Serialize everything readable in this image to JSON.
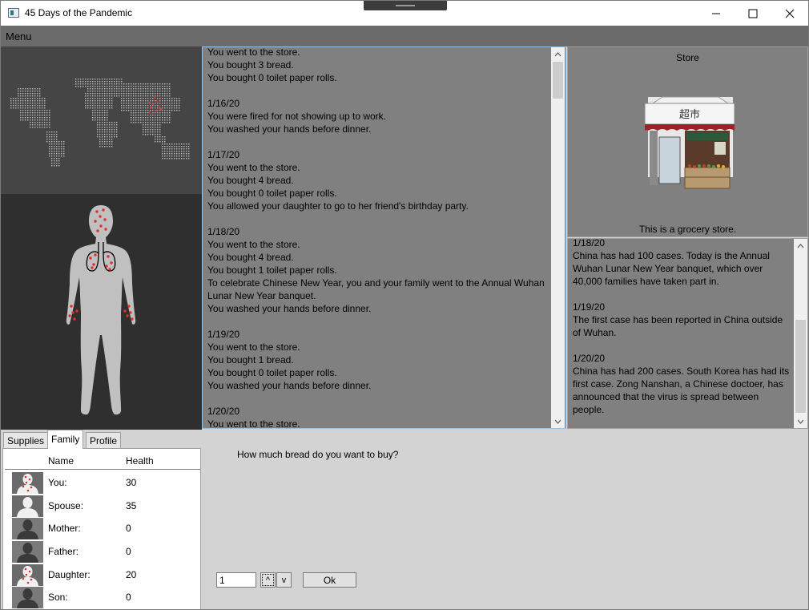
{
  "window": {
    "title": "45 Days of the Pandemic"
  },
  "menubar": {
    "menu_label": "Menu"
  },
  "log": {
    "text": "You went to the store.\nYou bought 3 bread.\nYou bought 0 toilet paper rolls.\n\n1/16/20\nYou were fired for not showing up to work.\nYou washed your hands before dinner.\n\n1/17/20\nYou went to the store.\nYou bought 4 bread.\nYou bought 0 toilet paper rolls.\nYou allowed your daughter to go to her friend's birthday party.\n\n1/18/20\nYou went to the store.\nYou bought 4 bread.\nYou bought 1 toilet paper rolls.\nTo celebrate Chinese New Year, you and your family went to the Annual Wuhan\nLunar New Year banquet.\nYou washed your hands before dinner.\n\n1/19/20\nYou went to the store.\nYou bought 1 bread.\nYou bought 0 toilet paper rolls.\nYou washed your hands before dinner.\n\n1/20/20\nYou went to the store."
  },
  "store": {
    "title": "Store",
    "caption": "This is a grocery store.",
    "sign_text": "超市"
  },
  "news": {
    "text": "1/18/20\nChina has had 100 cases. Today is the Annual\nWuhan Lunar New Year banquet, which over\n40,000 families have taken part in.\n\n1/19/20\nThe first case has been reported in China outside\nof Wuhan.\n\n1/20/20\nChina has had 200 cases. South Korea has had its\nfirst case. Zong Nanshan, a Chinese doctoer, has\nannounced that the virus is spread between\npeople."
  },
  "tabs": [
    {
      "label": "Supplies"
    },
    {
      "label": "Family"
    },
    {
      "label": "Profile"
    }
  ],
  "family": {
    "col_name": "Name",
    "col_health": "Health",
    "members": [
      {
        "name": "You:",
        "health": "30",
        "avatar": "infected"
      },
      {
        "name": "Spouse:",
        "health": "35",
        "avatar": "healthy"
      },
      {
        "name": "Mother:",
        "health": "0",
        "avatar": "deceased"
      },
      {
        "name": "Father:",
        "health": "0",
        "avatar": "deceased"
      },
      {
        "name": "Daughter:",
        "health": "20",
        "avatar": "infected"
      },
      {
        "name": "Son:",
        "health": "0",
        "avatar": "deceased"
      }
    ]
  },
  "prompt": {
    "question": "How much bread do you want to buy?",
    "quantity_value": "1",
    "step_up_label": "^",
    "step_down_label": "v",
    "ok_label": "Ok"
  },
  "colors": {
    "panel_gray": "#808080",
    "infection_red": "#e03030",
    "menubar": "#6b6b6b"
  }
}
